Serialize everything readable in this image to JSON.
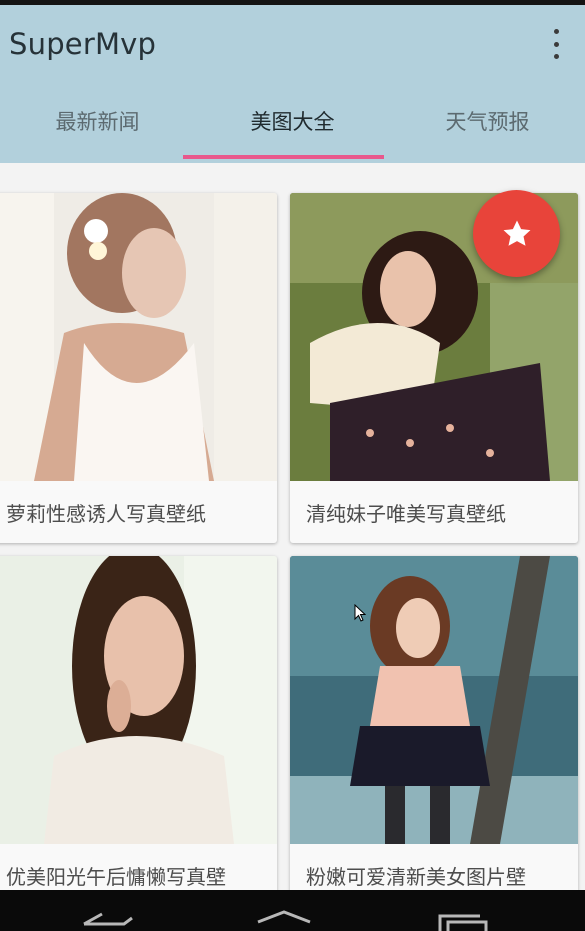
{
  "app": {
    "title": "SuperMvp"
  },
  "tabs": [
    {
      "label": "最新新闻"
    },
    {
      "label": "美图大全"
    },
    {
      "label": "天气预报"
    }
  ],
  "active_tab": "美图大全",
  "cards": [
    {
      "caption": "萝莉性感诱人写真壁纸"
    },
    {
      "caption": "清纯妹子唯美写真壁纸"
    },
    {
      "caption": "优美阳光午后慵懒写真壁"
    },
    {
      "caption": "粉嫩可爱清新美女图片壁"
    }
  ],
  "fab": {
    "icon": "star-icon"
  },
  "colors": {
    "appbar": "#b2d0dc",
    "indicator": "#e8588c",
    "fab": "#e8443a"
  },
  "navbar": {
    "icons": [
      "back-icon",
      "home-icon",
      "recents-icon"
    ]
  }
}
